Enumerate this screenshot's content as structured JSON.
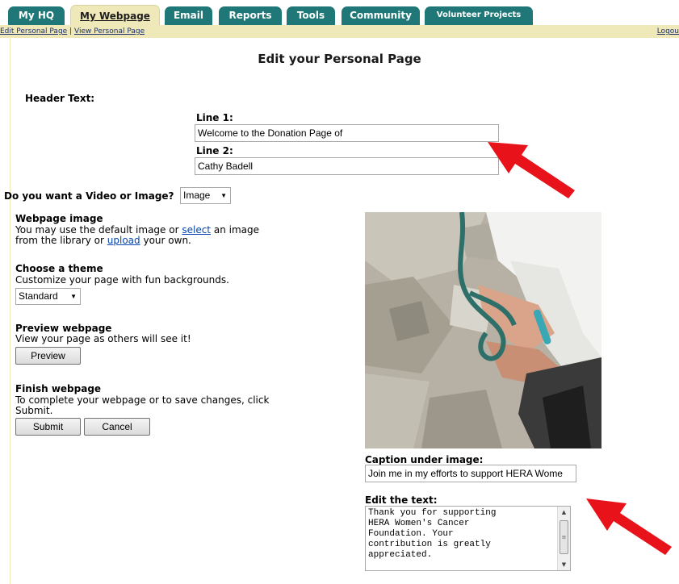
{
  "tabs": [
    {
      "label": "My HQ",
      "active": false
    },
    {
      "label": "My Webpage",
      "active": true
    },
    {
      "label": "Email",
      "active": false
    },
    {
      "label": "Reports",
      "active": false
    },
    {
      "label": "Tools",
      "active": false
    },
    {
      "label": "Community",
      "active": false
    },
    {
      "label": "Volunteer Projects",
      "active": false
    }
  ],
  "subnav": {
    "edit_link": "Edit Personal Page",
    "separator": "|",
    "view_link": "View Personal Page",
    "logout": "Logou"
  },
  "page_title": "Edit your Personal Page",
  "header_section": {
    "label": "Header Text:",
    "line1_label": "Line 1:",
    "line1_value": "Welcome to the Donation Page of",
    "line2_label": "Line 2:",
    "line2_value": "Cathy Badell"
  },
  "media": {
    "question": "Do you want a Video or Image?",
    "selected": "Image"
  },
  "webpage_image": {
    "title": "Webpage image",
    "text_before": "You may use the default image or",
    "select_link": "select",
    "text_middle": "an image",
    "text_line2_before": "from the library or",
    "upload_link": "upload",
    "text_after": "your own."
  },
  "theme": {
    "title": "Choose a theme",
    "desc": "Customize your page with fun backgrounds.",
    "selected": "Standard"
  },
  "preview": {
    "title": "Preview webpage",
    "desc": "View your page as others will see it!",
    "button": "Preview"
  },
  "finish": {
    "title": "Finish webpage",
    "desc1": "To complete your webpage or to save changes, click",
    "desc2": "Submit.",
    "submit": "Submit",
    "cancel": "Cancel"
  },
  "caption": {
    "label": "Caption under image:",
    "value": "Join me in my efforts to support HERA Wome"
  },
  "edit_text": {
    "label": "Edit the text:",
    "value": "Thank you for supporting\nHERA Women's Cancer\nFoundation. Your\ncontribution is greatly\nappreciated."
  },
  "colors": {
    "tab_teal": "#1f7777",
    "tab_active_bg": "#efe8b9",
    "arrow_red": "#e8121b",
    "link_blue": "#0645ad"
  }
}
